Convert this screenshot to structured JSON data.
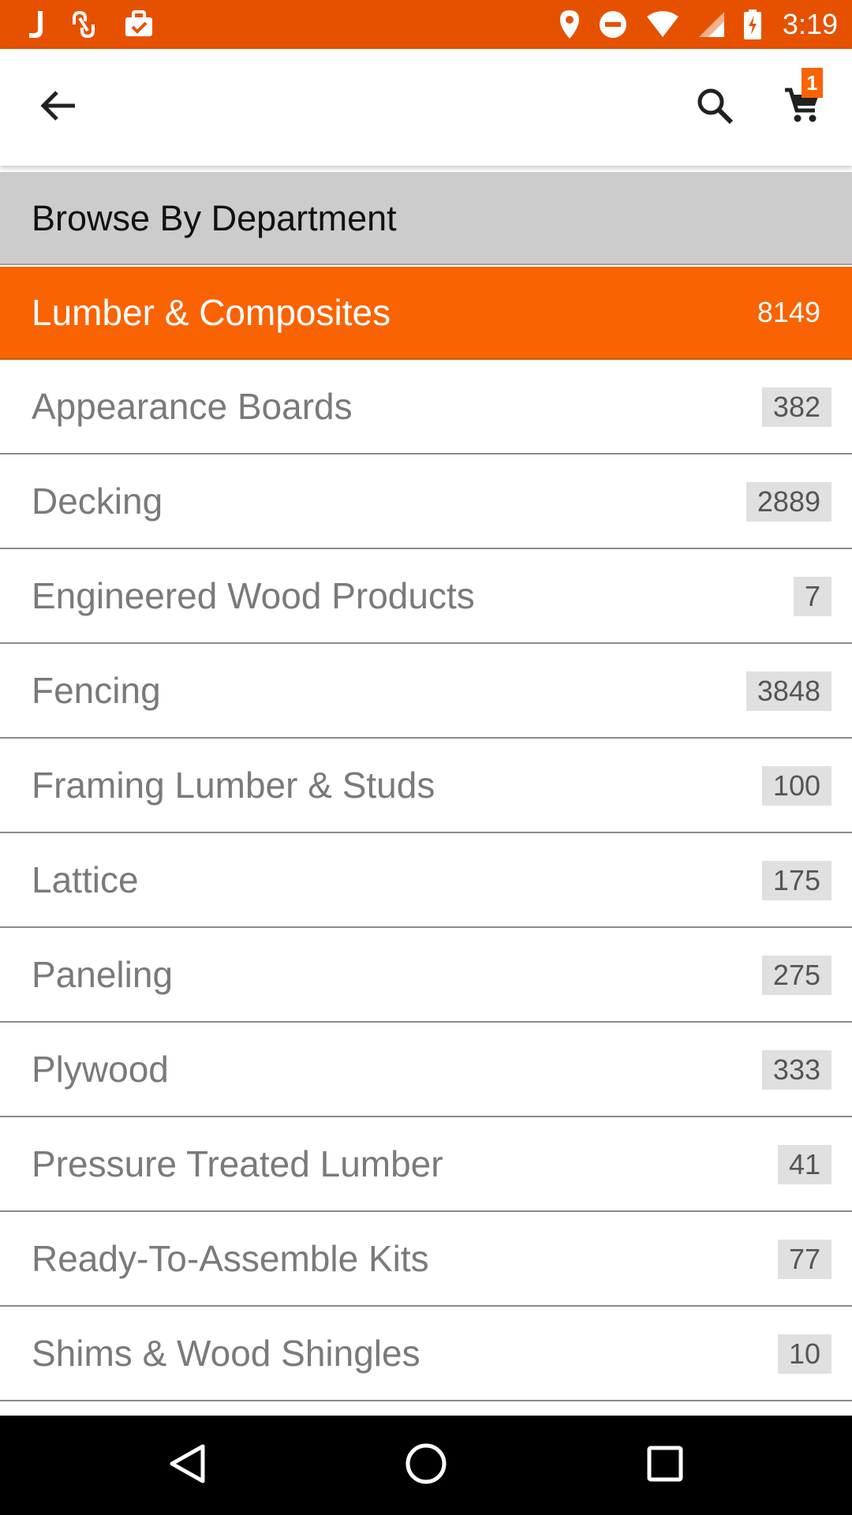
{
  "status_bar": {
    "time": "3:19",
    "left_icons": [
      "j-app-icon",
      "link-app-icon",
      "briefcase-check-icon"
    ],
    "right_icons": [
      "location-icon",
      "do-not-disturb-icon",
      "wifi-icon",
      "signal-icon",
      "battery-charging-icon"
    ],
    "background": "#E65100"
  },
  "app_bar": {
    "back_icon": "arrow-back-icon",
    "search_icon": "search-icon",
    "cart_icon": "shopping-cart-icon",
    "cart_count": "1"
  },
  "section": {
    "title": "Browse By Department"
  },
  "selected_department": {
    "label": "Lumber & Composites",
    "count": "8149",
    "accent": "#F96302"
  },
  "categories": [
    {
      "label": "Appearance Boards",
      "count": "382"
    },
    {
      "label": "Decking",
      "count": "2889"
    },
    {
      "label": "Engineered Wood Products",
      "count": "7"
    },
    {
      "label": "Fencing",
      "count": "3848"
    },
    {
      "label": "Framing Lumber & Studs",
      "count": "100"
    },
    {
      "label": "Lattice",
      "count": "175"
    },
    {
      "label": "Paneling",
      "count": "275"
    },
    {
      "label": "Plywood",
      "count": "333"
    },
    {
      "label": "Pressure Treated Lumber",
      "count": "41"
    },
    {
      "label": "Ready-To-Assemble Kits",
      "count": "77"
    },
    {
      "label": "Shims & Wood Shingles",
      "count": "10"
    }
  ],
  "nav_bar": {
    "back_icon": "nav-back-icon",
    "home_icon": "nav-home-icon",
    "recents_icon": "nav-recents-icon"
  }
}
